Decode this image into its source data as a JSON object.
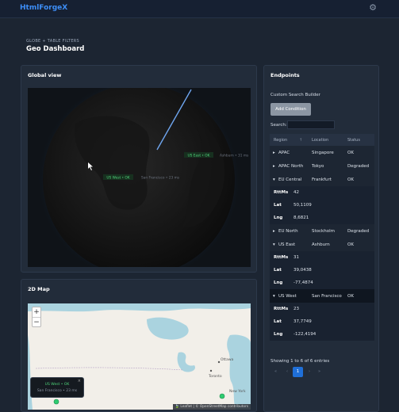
{
  "app": {
    "brand": "HtmlForgeX",
    "settings_icon": "gear-icon"
  },
  "header": {
    "breadcrumb": "GLOBE + TABLE FILTERS",
    "title": "Geo Dashboard"
  },
  "globe_card": {
    "title": "Global view",
    "labels": [
      {
        "name": "US East",
        "status": "OK",
        "text": "US East • OK"
      },
      {
        "name": "US West",
        "status": "OK",
        "text": "US West • OK"
      },
      {
        "name": "Ashburn",
        "text": "Ashburn • 31 ms"
      },
      {
        "name": "San Francisco",
        "text": "San Francisco • 23 ms"
      }
    ]
  },
  "map_card": {
    "title": "2D Map",
    "zoom_in": "+",
    "zoom_out": "−",
    "popup": {
      "title": "US West • OK",
      "sub": "San Francisco • 23 ms",
      "close": "×"
    },
    "cities": {
      "ottawa": "Ottawa",
      "toronto": "Toronto",
      "new_york": "New York"
    },
    "attribution": "🍃 Leaflet | © OpenStreetMap contributors"
  },
  "endpoints": {
    "title": "Endpoints",
    "builder_label": "Custom Search Builder",
    "add_condition": "Add Condition",
    "search_label": "Search:",
    "search_value": "",
    "columns": {
      "region": "Region",
      "location": "Location",
      "status": "Status"
    },
    "rows": [
      {
        "region": "APAC",
        "location": "Singapore",
        "status": "OK",
        "expanded": false
      },
      {
        "region": "APAC North",
        "location": "Tokyo",
        "status": "Degraded",
        "expanded": false
      },
      {
        "region": "EU Central",
        "location": "Frankfurt",
        "status": "OK",
        "expanded": true,
        "details": {
          "rtt_label": "RttMs",
          "rtt": "42",
          "lat_label": "Lat",
          "lat": "50,1109",
          "lng_label": "Lng",
          "lng": "8,6821"
        }
      },
      {
        "region": "EU North",
        "location": "Stockholm",
        "status": "Degraded",
        "expanded": false
      },
      {
        "region": "US East",
        "location": "Ashburn",
        "status": "OK",
        "expanded": true,
        "details": {
          "rtt_label": "RttMs",
          "rtt": "31",
          "lat_label": "Lat",
          "lat": "39,0438",
          "lng_label": "Lng",
          "lng": "-77,4874"
        }
      },
      {
        "region": "US West",
        "location": "San Francisco",
        "status": "OK",
        "expanded": true,
        "details": {
          "rtt_label": "RttMs",
          "rtt": "23",
          "lat_label": "Lat",
          "lat": "37,7749",
          "lng_label": "Lng",
          "lng": "-122,4194"
        }
      }
    ],
    "info": "Showing 1 to 6 of 6 entries",
    "pager": {
      "first": "«",
      "prev": "‹",
      "current": "1",
      "next": "›",
      "last": "»"
    }
  },
  "colors": {
    "accent": "#3d8ef7",
    "ok_green": "#2ecc71",
    "page_bg": "#1c2532"
  }
}
